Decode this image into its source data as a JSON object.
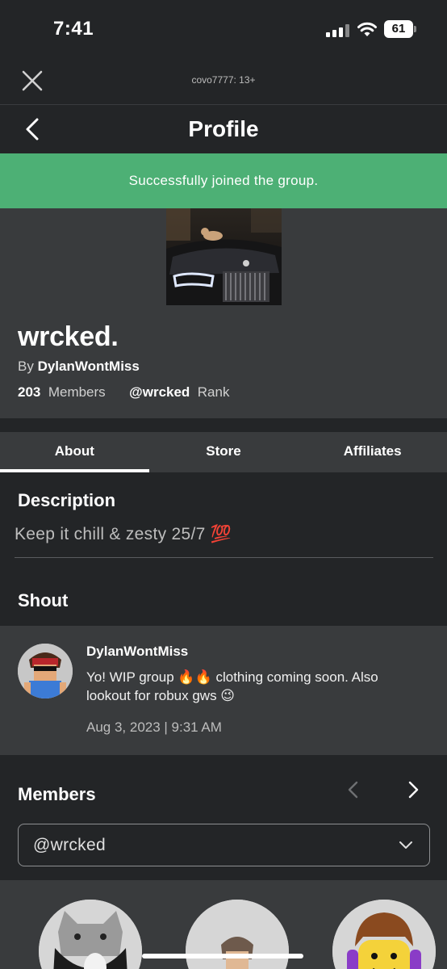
{
  "status_bar": {
    "time": "7:41",
    "battery": "61"
  },
  "webview": {
    "title": "covo7777: 13+"
  },
  "nav": {
    "title": "Profile"
  },
  "banner": {
    "message": "Successfully joined the group.",
    "color": "#4db075"
  },
  "group": {
    "name": "wrcked.",
    "by_label": "By",
    "owner": "DylanWontMiss",
    "member_count": "203",
    "members_label": "Members",
    "rank": "@wrcked",
    "rank_label": "Rank"
  },
  "tabs": [
    {
      "label": "About",
      "active": true
    },
    {
      "label": "Store",
      "active": false
    },
    {
      "label": "Affiliates",
      "active": false
    }
  ],
  "description": {
    "heading": "Description",
    "text": "Keep it chill & zesty 25/7 💯"
  },
  "shout": {
    "heading": "Shout",
    "author": "DylanWontMiss",
    "body": "Yo! WIP group 🔥🔥 clothing coming soon. Also lookout for robux gws 😉",
    "date": "Aug 3, 2023 | 9:31 AM"
  },
  "members": {
    "heading": "Members",
    "selected_rank": "@wrcked",
    "avatars": [
      "member-avatar-cat-hat",
      "member-avatar-helmet",
      "member-avatar-noob"
    ]
  },
  "colors": {
    "background": "#232527",
    "card": "#393b3d",
    "success": "#4db075"
  }
}
